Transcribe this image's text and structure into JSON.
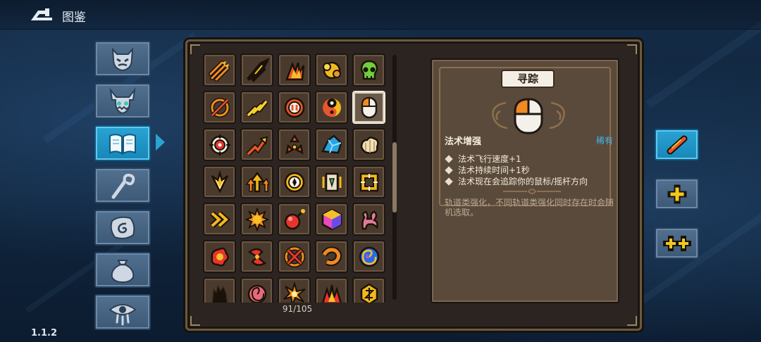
{
  "header": {
    "back_icon": "back-arrow-icon",
    "title": "图鉴"
  },
  "version": "1.1.2",
  "categories": [
    {
      "id": "enemies",
      "icon": "monster-face-icon",
      "active": false
    },
    {
      "id": "bosses",
      "icon": "horned-demon-icon",
      "active": false
    },
    {
      "id": "spellbook",
      "icon": "open-book-icon",
      "active": true
    },
    {
      "id": "staffs",
      "icon": "wand-icon",
      "active": false
    },
    {
      "id": "relics",
      "icon": "spiral-stone-icon",
      "active": false
    },
    {
      "id": "items",
      "icon": "pouch-icon",
      "active": false
    },
    {
      "id": "curses",
      "icon": "weeping-eye-icon",
      "active": false
    }
  ],
  "grid": {
    "counter": "91/105",
    "selected_index": 9,
    "cells": [
      "triple-arrow-icon",
      "flame-arrows-icon",
      "fire-burst-arrows-icon",
      "golden-explosion-icon",
      "green-skull-icon",
      "orbit-arrow-icon",
      "lightning-zigzag-icon",
      "pause-coin-icon",
      "yin-yang-icon",
      "mouse-icon",
      "crosshair-icon",
      "rising-arrow-icon",
      "triangle-arrows-icon",
      "blue-crystal-icon",
      "cream-worm-icon",
      "golden-wings-icon",
      "triple-up-arrow-icon",
      "gear-eye-icon",
      "card-cage-icon",
      "gold-frame-icon",
      "double-chevron-icon",
      "orange-sun-icon",
      "red-bomb-icon",
      "rainbow-cube-icon",
      "pink-coral-icon",
      "red-flower-icon",
      "red-swirl-icon",
      "cross-target-icon",
      "red-hook-icon",
      "blue-vortex-icon",
      "dark-tower-icon",
      "pink-rose-icon",
      "spark-burst-icon",
      "red-spikes-icon",
      "golden-rune-icon"
    ]
  },
  "detail": {
    "name": "寻踪",
    "icon": "mouse-icon",
    "category": "法术增强",
    "rarity": "稀有",
    "effects": [
      "法术飞行速度+1",
      "法术持续时间+1秒",
      "法术现在会追踪你的鼠标/摇杆方向"
    ],
    "note": "轨道类强化，不同轨道类强化同时存在时会随机选取。"
  },
  "side_buttons": [
    {
      "id": "slot-1",
      "icon": "slash-icon",
      "active": true
    },
    {
      "id": "slot-2",
      "icon": "plus-icon",
      "active": false
    },
    {
      "id": "slot-3",
      "icon": "double-plus-icon",
      "active": false
    }
  ],
  "colors": {
    "background": "#142b46",
    "tab_active": "#2aa3d3",
    "tab_inactive": "#4a6888",
    "panel": "#2b2420",
    "cell": "#4a3a2e",
    "rarity_text": "#3fb8f0"
  }
}
